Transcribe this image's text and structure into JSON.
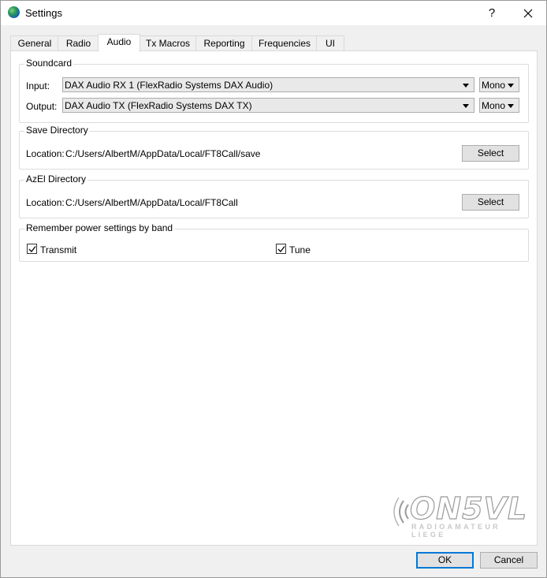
{
  "window": {
    "title": "Settings",
    "help_glyph": "?",
    "close_glyph": "✕"
  },
  "tabs": [
    {
      "label": "General"
    },
    {
      "label": "Radio"
    },
    {
      "label": "Audio",
      "active": true
    },
    {
      "label": "Tx Macros"
    },
    {
      "label": "Reporting"
    },
    {
      "label": "Frequencies"
    },
    {
      "label": "UI"
    }
  ],
  "soundcard": {
    "title": "Soundcard",
    "input_label": "Input:",
    "input_device": "DAX Audio RX 1 (FlexRadio Systems DAX Audio)",
    "input_channel": "Mono",
    "output_label": "Output:",
    "output_device": "DAX Audio TX (FlexRadio Systems DAX TX)",
    "output_channel": "Mono"
  },
  "save_directory": {
    "title": "Save Directory",
    "location_label": "Location:",
    "path": "C:/Users/AlbertM/AppData/Local/FT8Call/save",
    "select_label": "Select"
  },
  "azel_directory": {
    "title": "AzEl Directory",
    "location_label": "Location:",
    "path": "C:/Users/AlbertM/AppData/Local/FT8Call",
    "select_label": "Select"
  },
  "power_settings": {
    "title": "Remember power settings by band",
    "transmit_label": "Transmit",
    "transmit_checked": true,
    "tune_label": "Tune",
    "tune_checked": true
  },
  "watermark": {
    "main": "ON5VL",
    "sub": "RADIOAMATEUR LIEGE"
  },
  "footer": {
    "ok_label": "OK",
    "cancel_label": "Cancel"
  },
  "colors": {
    "accent": "#0078d7",
    "window_bg": "#f0f0f0",
    "panel_bg": "#ffffff"
  }
}
